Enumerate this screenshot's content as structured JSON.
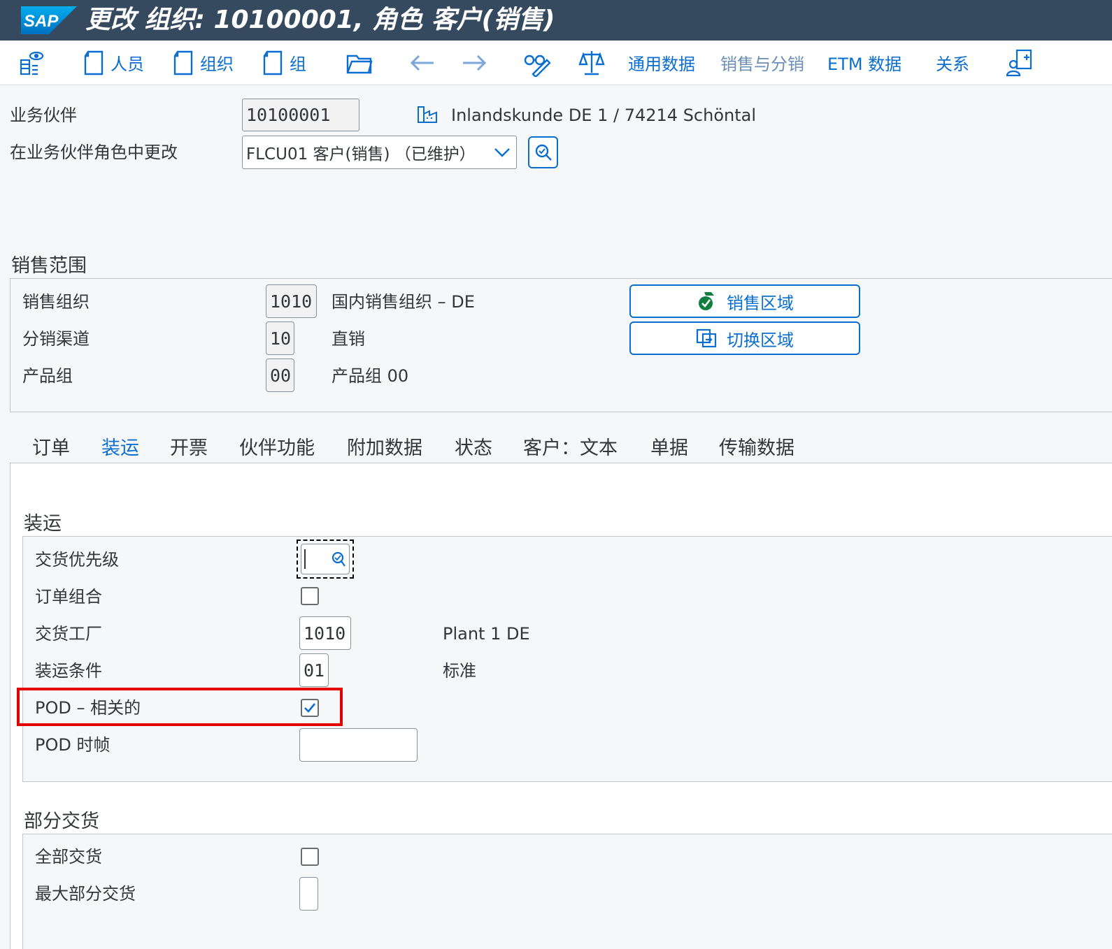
{
  "title_bar": {
    "title": "更改 组织: 10100001, 角色 客户(销售)",
    "logo_text": "SAP"
  },
  "toolbar": {
    "person_label": "人员",
    "org_label": "组织",
    "group_label": "组",
    "general_data_label": "通用数据",
    "sales_distribution_label": "销售与分销",
    "etm_data_label": "ETM 数据",
    "relations_label": "关系"
  },
  "header": {
    "bp_label": "业务伙伴",
    "bp_value": "10100001",
    "bp_description": "Inlandskunde DE 1 / 74214 Schöntal",
    "role_label": "在业务伙伴角色中更改",
    "role_value": "FLCU01  客户(销售) （已维护）"
  },
  "sales_area": {
    "section_title": "销售范围",
    "sales_org_label": "销售组织",
    "sales_org_value": "1010",
    "sales_org_desc": "国内销售组织 – DE",
    "dist_channel_label": "分销渠道",
    "dist_channel_value": "10",
    "dist_channel_desc": "直销",
    "division_label": "产品组",
    "division_value": "00",
    "division_desc": "产品组 00",
    "sales_areas_button": "销售区域",
    "switch_area_button": "切换区域"
  },
  "tabs": [
    "订单",
    "装运",
    "开票",
    "伙伴功能",
    "附加数据",
    "状态",
    "客户：文本",
    "单据",
    "传输数据"
  ],
  "shipping": {
    "section_title": "装运",
    "delivery_priority_label": "交货优先级",
    "delivery_priority_value": "",
    "order_combination_label": "订单组合",
    "order_combination_checked": false,
    "delivering_plant_label": "交货工厂",
    "delivering_plant_value": "1010",
    "delivering_plant_desc": "Plant 1 DE",
    "shipping_conditions_label": "装运条件",
    "shipping_conditions_value": "01",
    "shipping_conditions_desc": "标准",
    "pod_relevant_label": "POD – 相关的",
    "pod_relevant_checked": true,
    "pod_timeframe_label": "POD 时帧",
    "pod_timeframe_value": ""
  },
  "partial_delivery": {
    "section_title": "部分交货",
    "complete_delivery_label": "全部交货",
    "complete_delivery_checked": false,
    "max_partial_label": "最大部分交货",
    "max_partial_value": ""
  },
  "colors": {
    "title_bar": "#354a5f",
    "accent": "#0a6ed1",
    "highlight": "#e30000",
    "success": "#107e3e"
  }
}
